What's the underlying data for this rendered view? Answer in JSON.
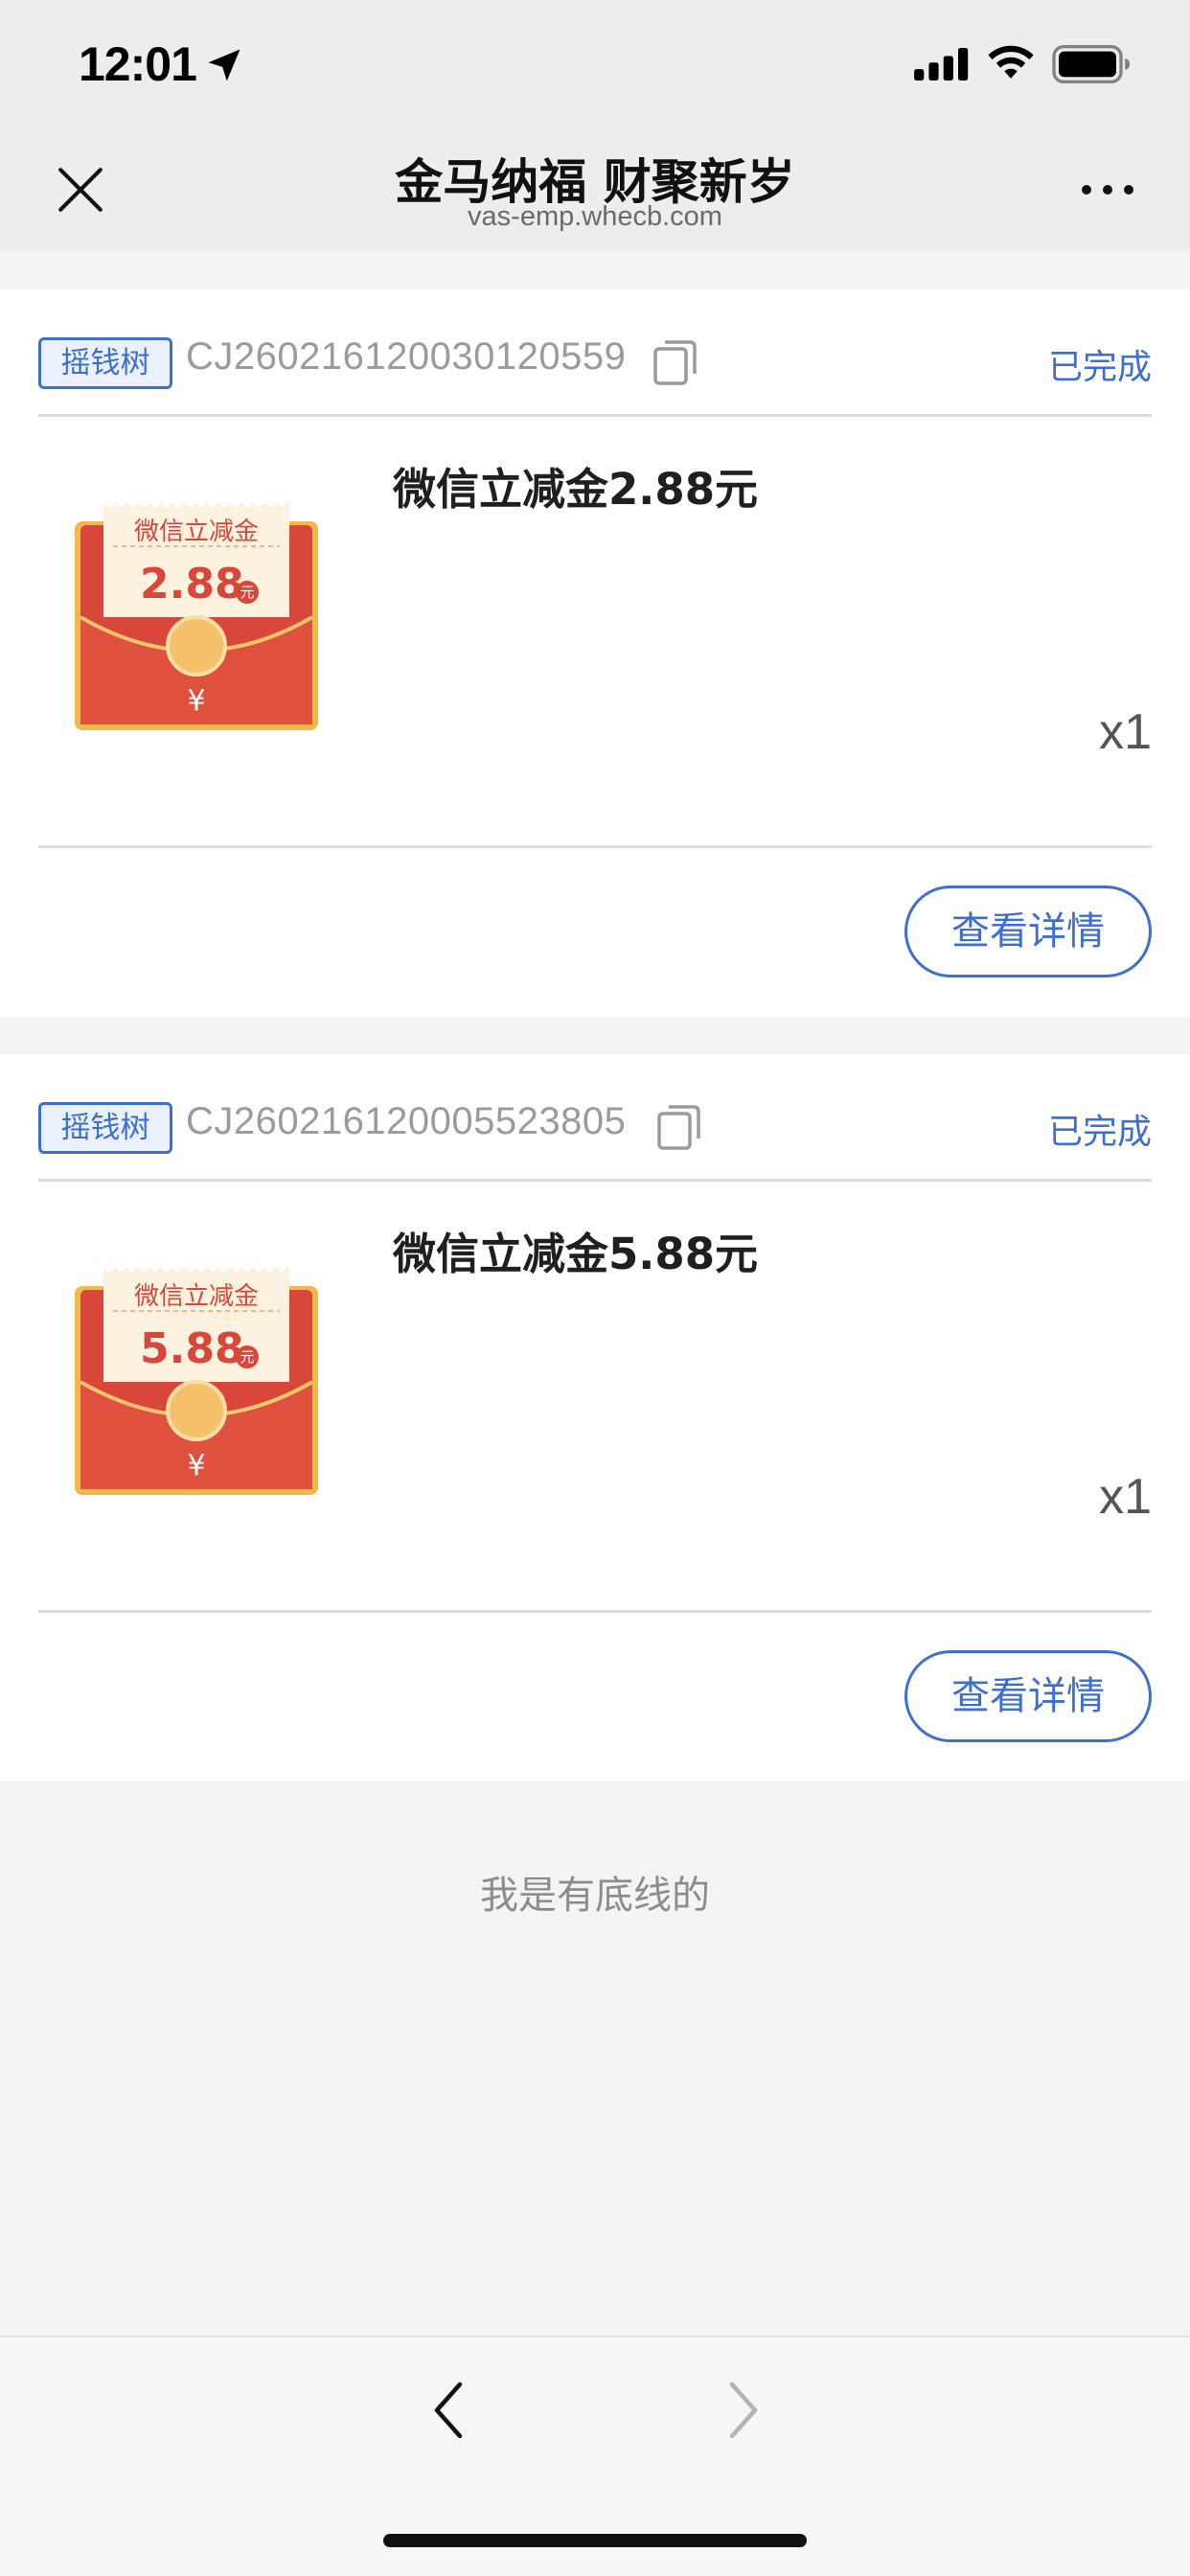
{
  "status_bar": {
    "time": "12:01",
    "icons": [
      "location-arrow-icon",
      "cellular-signal-icon",
      "wifi-icon",
      "battery-icon"
    ]
  },
  "nav": {
    "title": "金马纳福 财聚新岁",
    "subtitle": "vas-emp.whecb.com",
    "icons": [
      "close-icon",
      "more-icon"
    ]
  },
  "orders": [
    {
      "tag": "摇钱树",
      "order_no": "CJ260216120030120559",
      "status": "已完成",
      "item_title": "微信立减金2.88元",
      "quantity": "x1",
      "button": "查看详情",
      "thumb": {
        "label": "微信立减金",
        "amount": "2.88",
        "unit": "元",
        "coin": "¥"
      }
    },
    {
      "tag": "摇钱树",
      "order_no": "CJ260216120005523805",
      "status": "已完成",
      "item_title": "微信立减金5.88元",
      "quantity": "x1",
      "button": "查看详情",
      "thumb": {
        "label": "微信立减金",
        "amount": "5.88",
        "unit": "元",
        "coin": "¥"
      }
    }
  ],
  "footer_note": "我是有底线的",
  "toolbar": {
    "icons": [
      "back-arrow-icon",
      "forward-arrow-icon"
    ]
  },
  "colors": {
    "accent": "#3d6fd0",
    "envelope_red": "#d9473b",
    "envelope_gold": "#f2b94a",
    "background": "#f4f4f5"
  }
}
